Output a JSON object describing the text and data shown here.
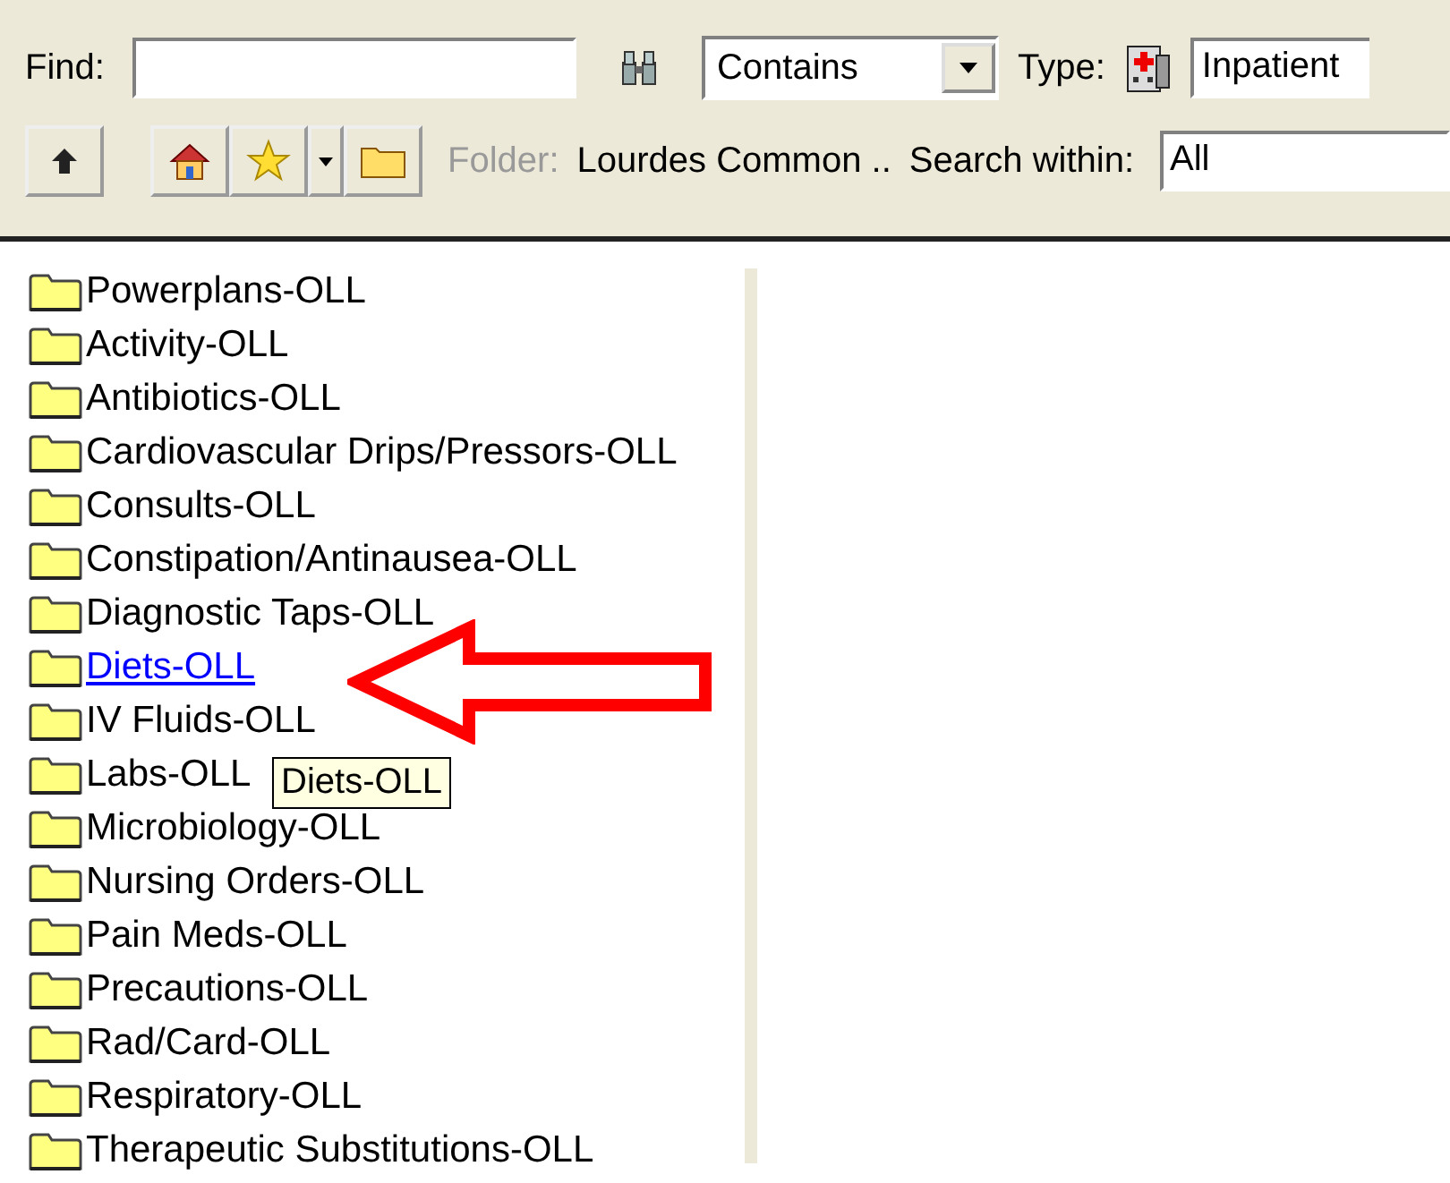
{
  "toolbar": {
    "find_label": "Find:",
    "match_mode": "Contains",
    "type_label": "Type:",
    "type_value": "Inpatient",
    "folder_label": "Folder:",
    "folder_value": "Lourdes Common ..",
    "search_within_label": "Search within:",
    "search_within_value": "All"
  },
  "folders": [
    {
      "name": "Powerplans-OLL",
      "hovered": false
    },
    {
      "name": "Activity-OLL",
      "hovered": false
    },
    {
      "name": "Antibiotics-OLL",
      "hovered": false
    },
    {
      "name": "Cardiovascular Drips/Pressors-OLL",
      "hovered": false
    },
    {
      "name": "Consults-OLL",
      "hovered": false
    },
    {
      "name": "Constipation/Antinausea-OLL",
      "hovered": false
    },
    {
      "name": "Diagnostic Taps-OLL",
      "hovered": false
    },
    {
      "name": "Diets-OLL",
      "hovered": true
    },
    {
      "name": "IV Fluids-OLL",
      "hovered": false
    },
    {
      "name": "Labs-OLL",
      "hovered": false
    },
    {
      "name": "Microbiology-OLL",
      "hovered": false
    },
    {
      "name": "Nursing Orders-OLL",
      "hovered": false
    },
    {
      "name": "Pain Meds-OLL",
      "hovered": false
    },
    {
      "name": "Precautions-OLL",
      "hovered": false
    },
    {
      "name": "Rad/Card-OLL",
      "hovered": false
    },
    {
      "name": "Respiratory-OLL",
      "hovered": false
    },
    {
      "name": "Therapeutic Substitutions-OLL",
      "hovered": false
    }
  ],
  "tooltip": {
    "text": "Diets-OLL"
  }
}
